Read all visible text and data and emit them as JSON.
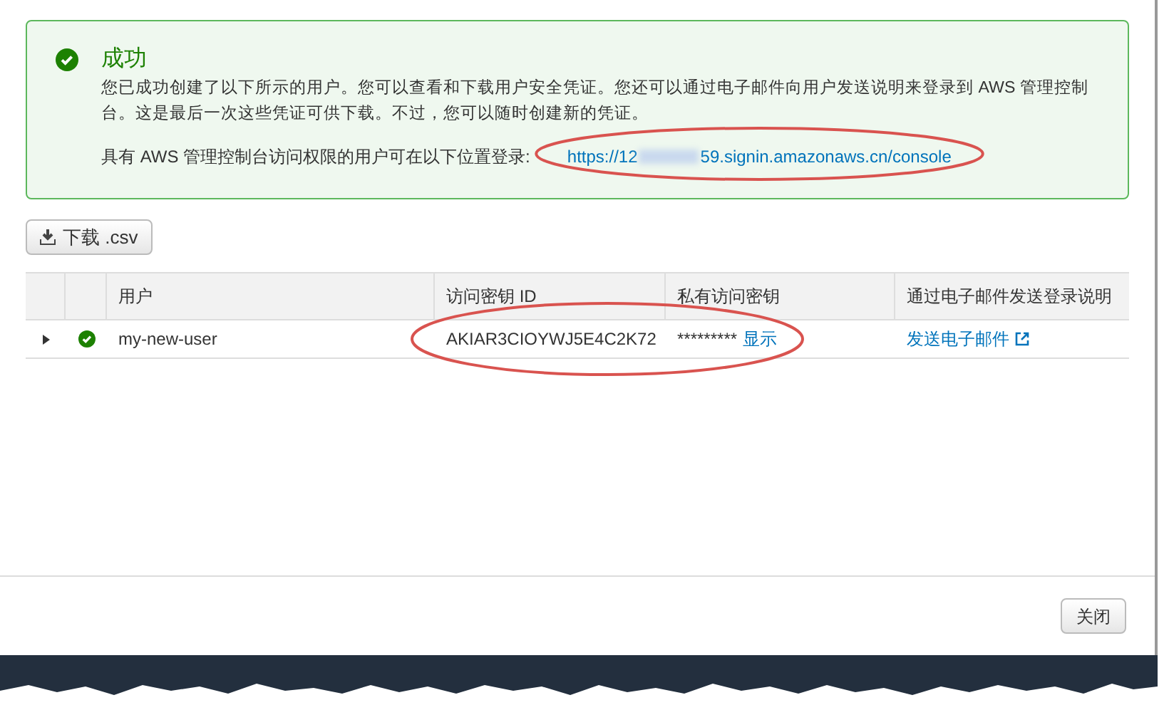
{
  "alert": {
    "title": "成功",
    "message": "您已成功创建了以下所示的用户。您可以查看和下载用户安全凭证。您还可以通过电子邮件向用户发送说明来登录到 AWS 管理控制台。这是最后一次这些凭证可供下载。不过，您可以随时创建新的凭证。",
    "login_label": "具有 AWS 管理控制台访问权限的用户可在以下位置登录:",
    "url_start": "https://12",
    "url_end": "59.signin.amazonaws.cn/console"
  },
  "download_button": "下载 .csv",
  "table": {
    "columns": [
      "用户",
      "访问密钥 ID",
      "私有访问密钥",
      "通过电子邮件发送登录说明"
    ],
    "rows": [
      {
        "expanded": false,
        "user": "my-new-user",
        "access_key_id": "AKIAR3CIOYWJ5E4C2K72",
        "secret_mask": "*********",
        "show_link": "显示",
        "email_link": "发送电子邮件"
      }
    ]
  },
  "close_button": "关闭"
}
